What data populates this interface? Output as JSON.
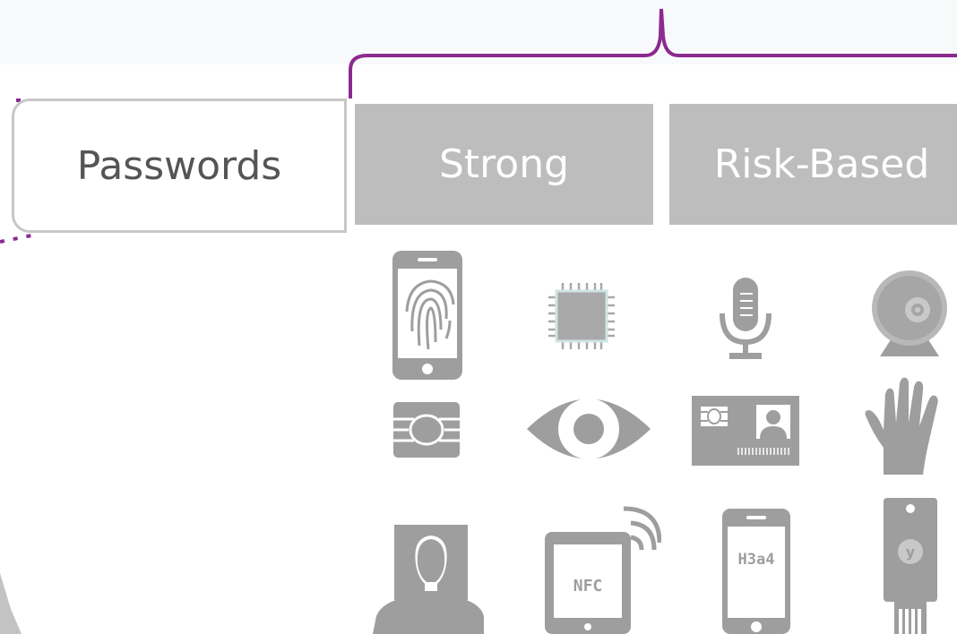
{
  "categories": {
    "passwords": "Passwords",
    "strong": "Strong",
    "risk_based": "Risk-Based"
  },
  "icons": [
    {
      "name": "fingerprint-phone-icon"
    },
    {
      "name": "chip-icon"
    },
    {
      "name": "microphone-icon"
    },
    {
      "name": "webcam-icon"
    },
    {
      "name": "smart-card-chip-icon"
    },
    {
      "name": "eye-icon"
    },
    {
      "name": "id-card-icon"
    },
    {
      "name": "hand-icon"
    },
    {
      "name": "face-portrait-icon"
    },
    {
      "name": "nfc-tablet-icon"
    },
    {
      "name": "otp-phone-icon"
    },
    {
      "name": "security-key-icon"
    }
  ],
  "labels": {
    "nfc": "NFC",
    "otp_code": "H3a4",
    "key_letter": "y"
  },
  "colors": {
    "bracket": "#8b2a8f",
    "icon_gray": "#9e9e9e",
    "box_gray": "#bdbdbd"
  }
}
